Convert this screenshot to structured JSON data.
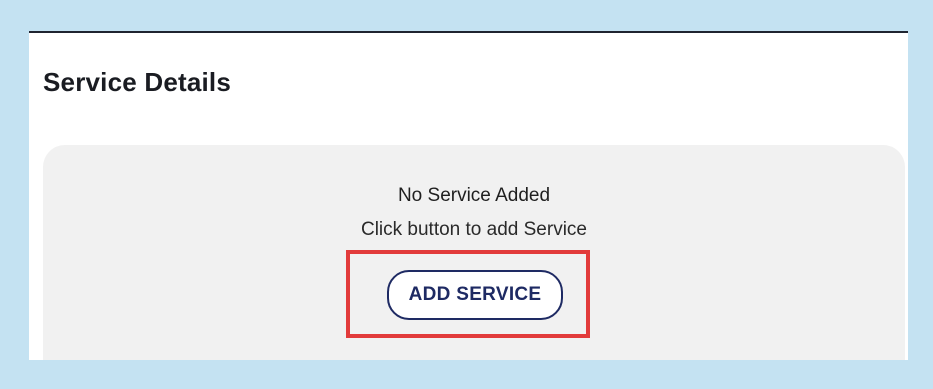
{
  "section": {
    "title": "Service Details"
  },
  "empty_state": {
    "title": "No Service Added",
    "subtitle": "Click button to add Service",
    "button_label": "ADD SERVICE"
  },
  "colors": {
    "background": "#c4e2f2",
    "panel": "#ffffff",
    "card": "#f1f1f1",
    "button_text": "#1e2a63",
    "highlight": "#e23b3b"
  }
}
